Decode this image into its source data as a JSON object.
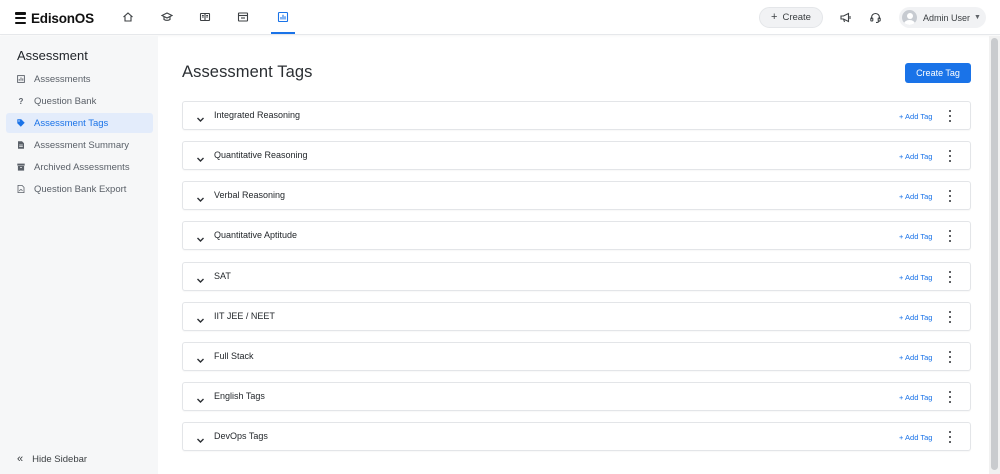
{
  "app": {
    "logo_text": "EdisonOS",
    "nav_icons": [
      "home-icon",
      "graduation-cap-icon",
      "book-icon",
      "store-icon",
      "analytics-icon"
    ],
    "active_nav_index": 4
  },
  "header": {
    "create_label": "Create",
    "icons": [
      "megaphone-icon",
      "headset-icon",
      "user-avatar-icon"
    ],
    "user_name": "Admin User"
  },
  "sidebar": {
    "title": "Assessment",
    "items": [
      {
        "label": "Assessments",
        "icon": "chart-box-icon",
        "active": false
      },
      {
        "label": "Question Bank",
        "icon": "question-mark-icon",
        "active": false
      },
      {
        "label": "Assessment Tags",
        "icon": "tag-icon",
        "active": true
      },
      {
        "label": "Assessment Summary",
        "icon": "document-icon",
        "active": false
      },
      {
        "label": "Archived Assessments",
        "icon": "archive-box-icon",
        "active": false
      },
      {
        "label": "Question Bank Export",
        "icon": "pdf-file-icon",
        "active": false
      }
    ],
    "hide_label": "Hide Sidebar"
  },
  "main": {
    "title": "Assessment Tags",
    "create_tag_label": "Create Tag",
    "add_tag_label": "+ Add Tag",
    "tags": [
      {
        "name": "Integrated Reasoning"
      },
      {
        "name": "Quantitative Reasoning"
      },
      {
        "name": "Verbal Reasoning"
      },
      {
        "name": "Quantitative Aptitude"
      },
      {
        "name": "SAT"
      },
      {
        "name": "IIT JEE / NEET"
      },
      {
        "name": "Full Stack"
      },
      {
        "name": "English Tags"
      },
      {
        "name": "DevOps Tags"
      }
    ]
  },
  "colors": {
    "accent": "#1a73e8",
    "sidebar_bg": "#f6f7f8",
    "active_item_bg": "#e3ecfb"
  }
}
